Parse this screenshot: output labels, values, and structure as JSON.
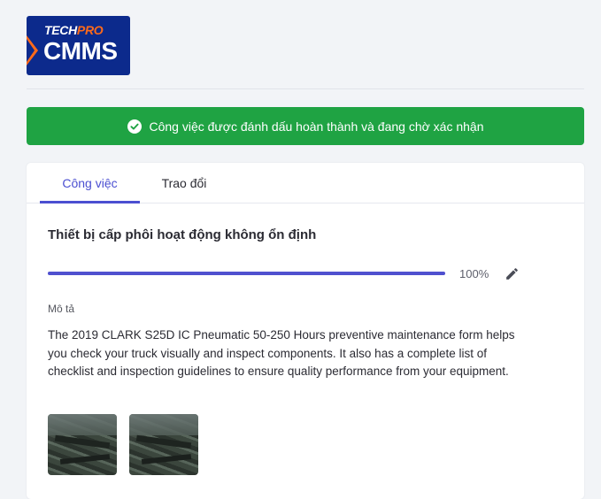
{
  "brand": {
    "top_tech": "TECH",
    "top_pro": "PRO",
    "name": "CMMS"
  },
  "banner": {
    "message": "Công việc được đánh dấu hoàn thành và đang chờ xác nhận",
    "icon": "check-circle-icon",
    "color": "#1fa343"
  },
  "tabs": [
    {
      "label": "Công việc",
      "active": true
    },
    {
      "label": "Trao đổi",
      "active": false
    }
  ],
  "task": {
    "title": "Thiết bị cấp phôi hoạt động không ổn định",
    "progress": 100,
    "progress_label": "100%",
    "edit_icon": "pencil-icon",
    "description_label": "Mô tả",
    "description": "The 2019 CLARK S25D IC Pneumatic 50-250 Hours preventive maintenance form helps you check your truck visually and inspect components. It also has a complete list of checklist and inspection guidelines to ensure quality performance from your equipment."
  },
  "colors": {
    "accent": "#4b4fd1",
    "progress": "#4f50cf",
    "success": "#1fa343",
    "brand_navy": "#0c2a8c",
    "brand_orange": "#ff6a1a"
  }
}
